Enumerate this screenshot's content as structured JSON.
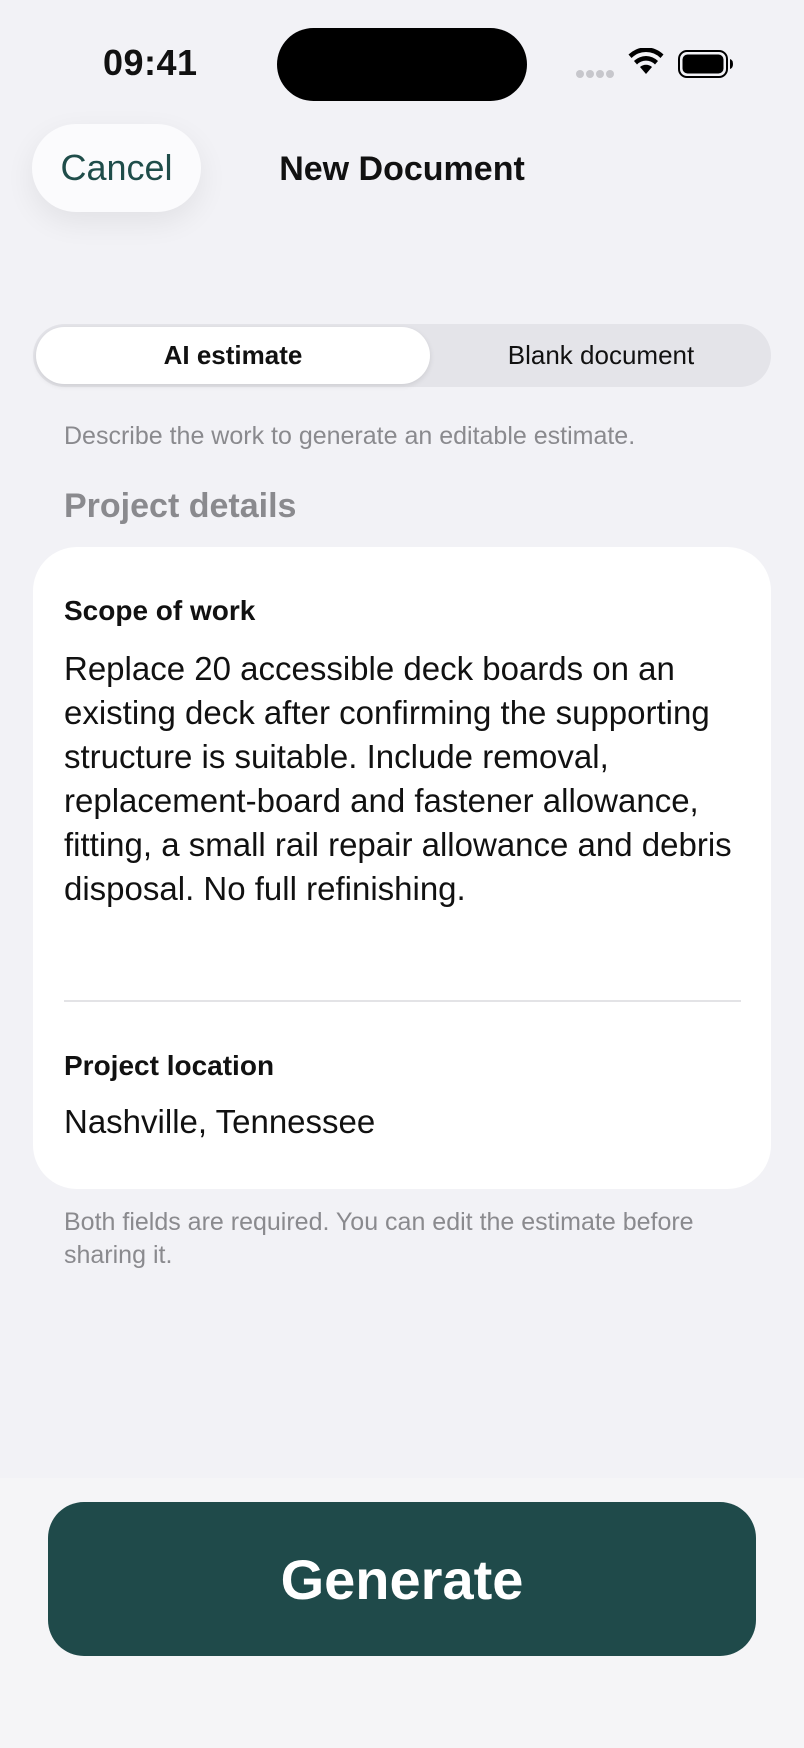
{
  "status_bar": {
    "time": "09:41",
    "icons": [
      "cellular-signal-icon",
      "wifi-icon",
      "battery-icon"
    ]
  },
  "nav": {
    "cancel_label": "Cancel",
    "title": "New Document"
  },
  "segmented_control": {
    "options": [
      "AI estimate",
      "Blank document"
    ],
    "selected": "AI estimate"
  },
  "description": "Describe the work to generate an editable estimate.",
  "section_header": "Project details",
  "form": {
    "scope_label": "Scope of work",
    "scope_value": "Replace 20 accessible deck boards on an existing deck after confirming the supporting structure is suitable. Include removal, replacement-board and fastener allowance, fitting, a small rail repair allowance and debris disposal. No full refinishing.",
    "location_label": "Project location",
    "location_value": "Nashville, Tennessee"
  },
  "footnote": "Both fields are required. You can edit the estimate before sharing it.",
  "generate_label": "Generate",
  "colors": {
    "accent": "#1F4A4A",
    "background": "#F2F2F6",
    "secondary_text": "#8A8A8E"
  }
}
